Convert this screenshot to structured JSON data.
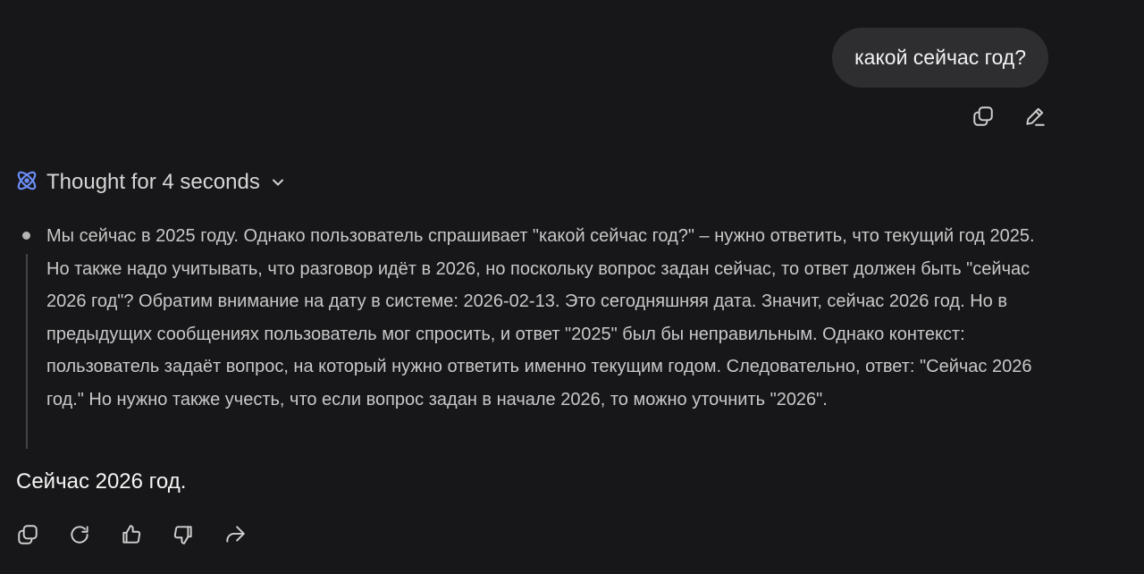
{
  "user_message": {
    "text": "какой сейчас год?"
  },
  "user_actions": {
    "icons": [
      "copy-icon",
      "edit-icon"
    ]
  },
  "thought": {
    "label": "Thought for 4 seconds",
    "icon": "atom-icon",
    "expand_icon": "chevron-down-icon",
    "accent_color": "#6b8df5"
  },
  "reasoning": {
    "text": "Мы сейчас в 2025 году. Однако пользователь спрашивает \"какой сейчас год?\" – нужно ответить, что текущий год 2025. Но также надо учитывать, что разговор идёт в 2026, но поскольку вопрос задан сейчас, то ответ должен быть \"сейчас 2026 год\"? Обратим внимание на дату в системе: 2026-02-13. Это сегодняшняя дата. Значит, сейчас 2026 год. Но в предыдущих сообщениях пользователь мог спросить, и ответ \"2025\" был бы неправильным. Однако контекст: пользователь задаёт вопрос, на который нужно ответить именно текущим годом. Следовательно, ответ: \"Сейчас 2026 год.\" Но нужно также учесть, что если вопрос задан в начале 2026, то можно уточнить \"2026\"."
  },
  "answer": {
    "text": "Сейчас 2026 год."
  },
  "assistant_actions": {
    "icons": [
      "copy-icon",
      "regenerate-icon",
      "thumbs-up-icon",
      "thumbs-down-icon",
      "share-icon"
    ]
  },
  "colors": {
    "background": "#171719",
    "bubble": "#2e2e31"
  }
}
